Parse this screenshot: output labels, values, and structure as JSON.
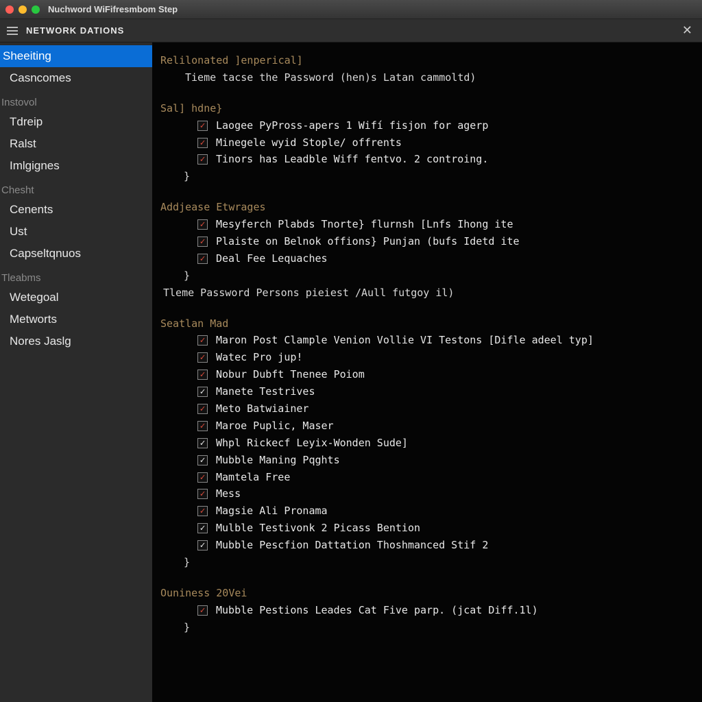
{
  "window": {
    "title": "Nuchword WiFifresmbom Step"
  },
  "toolbar": {
    "title": "NETWORK DATIONS",
    "close": "✕"
  },
  "sidebar": {
    "groups": [
      {
        "header": null,
        "items": [
          {
            "label": "Sheeiting",
            "active": true
          },
          {
            "label": "Casncomes"
          }
        ]
      },
      {
        "header": "Instovol",
        "items": [
          {
            "label": "Tdreip"
          },
          {
            "label": "Ralst"
          },
          {
            "label": "Imlgignes"
          }
        ]
      },
      {
        "header": "Chesht",
        "items": [
          {
            "label": "Cenents"
          },
          {
            "label": "Ust"
          },
          {
            "label": "Capseltqnuos"
          }
        ]
      },
      {
        "header": "Tleabms",
        "items": [
          {
            "label": "Wetegoal"
          },
          {
            "label": "Metworts"
          },
          {
            "label": "Nores Jaslg"
          }
        ]
      }
    ]
  },
  "content": {
    "sections": [
      {
        "title": "Relilonated ]enperical]",
        "pre_line": "Tieme tacse the Password (hen)s Latan cammoltd)",
        "post_line": null,
        "items": []
      },
      {
        "title": "Sal] hdne}",
        "pre_line": null,
        "post_line": null,
        "items": [
          {
            "style": "red",
            "label": "Laogee PyPross-apers 1 Wifí fisjon for agerp"
          },
          {
            "style": "red",
            "label": "Minegele wyid Stople/ offrents"
          },
          {
            "style": "red",
            "label": "Tinors has Leadble Wiff fentvo. 2 controing."
          }
        ]
      },
      {
        "title": "Addjease Etwrages",
        "pre_line": null,
        "post_line": "Tleme Password Persons pieiest /Aull futgoy il)",
        "items": [
          {
            "style": "red",
            "label": "Mesyferch Plabds Tnorte} flurnsh [Lnfs Ihong ite"
          },
          {
            "style": "red",
            "label": "Plaiste on Belnok offions} Punjan (bufs Idetd ite"
          },
          {
            "style": "red",
            "label": "Deal Fee Lequaches"
          }
        ]
      },
      {
        "title": "Seatlan Mad",
        "pre_line": null,
        "post_line": null,
        "items": [
          {
            "style": "red",
            "label": "Maron Post Clample Venion Vollie VI Testons [Difle adeel typ]"
          },
          {
            "style": "red",
            "label": "Watec Pro jup!"
          },
          {
            "style": "red",
            "label": "Nobur Dubft Tnenee Poiom"
          },
          {
            "style": "white",
            "label": "Manete Testrives"
          },
          {
            "style": "red",
            "label": "Meto Batwiainer"
          },
          {
            "style": "red",
            "label": "Maroe Puplic, Maser"
          },
          {
            "style": "white",
            "label": "Whpl Rickecf Leyix-Wonden Sude]"
          },
          {
            "style": "white",
            "label": "Mubble Maning Pqghts"
          },
          {
            "style": "red",
            "label": "Mamtela Free"
          },
          {
            "style": "red",
            "label": "Mess"
          },
          {
            "style": "red",
            "label": "Magsie Ali Pronama"
          },
          {
            "style": "white",
            "label": "Mulble Testivonk 2 Picass Bention"
          },
          {
            "style": "white",
            "label": "Mubble Pescfion Dattation Thoshmanced Stif 2"
          }
        ]
      },
      {
        "title": "Ouniness 20Vei",
        "pre_line": null,
        "post_line": null,
        "items": [
          {
            "style": "red",
            "label": "Mubble Pestions Leades Cat Five parp. (jcat Diff.1l)"
          }
        ]
      }
    ]
  }
}
